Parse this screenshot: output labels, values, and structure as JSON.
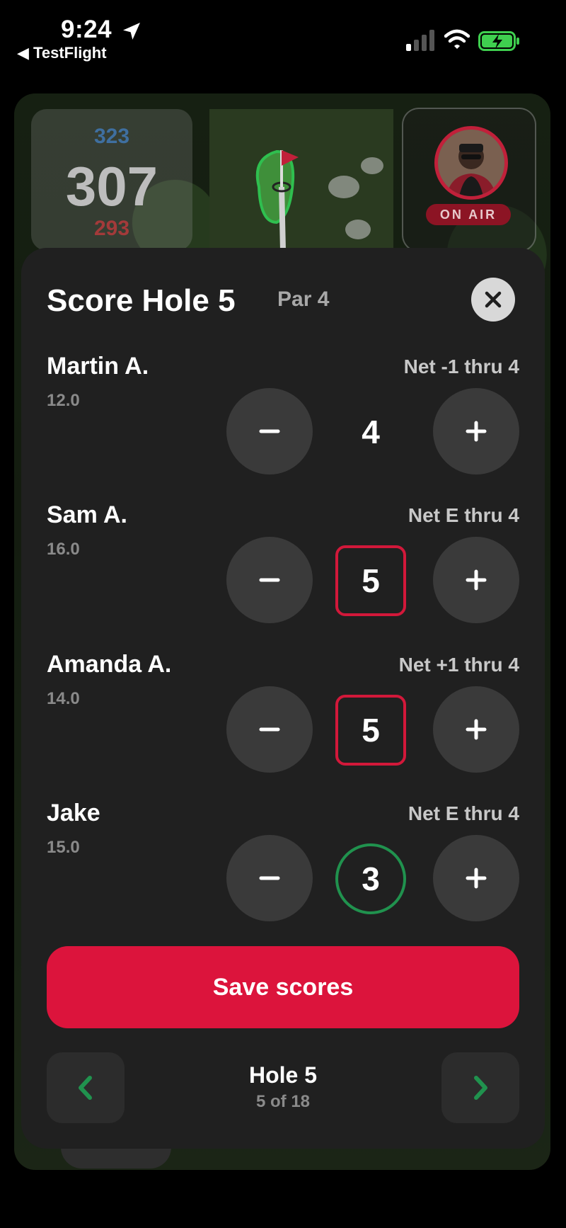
{
  "status_bar": {
    "time": "9:24",
    "back_app": "TestFlight"
  },
  "map_overlay": {
    "yardage_back": "323",
    "yardage_middle": "307",
    "yardage_front": "293",
    "on_air_label": "ON AIR"
  },
  "sheet": {
    "title": "Score Hole 5",
    "par": "Par 4",
    "players": [
      {
        "name": "Martin A.",
        "handicap": "12.0",
        "net": "Net -1 thru 4",
        "score": "4",
        "marker": "none"
      },
      {
        "name": "Sam A.",
        "handicap": "16.0",
        "net": "Net E thru 4",
        "score": "5",
        "marker": "box"
      },
      {
        "name": "Amanda A.",
        "handicap": "14.0",
        "net": "Net +1 thru 4",
        "score": "5",
        "marker": "box"
      },
      {
        "name": "Jake",
        "handicap": "15.0",
        "net": "Net E thru 4",
        "score": "3",
        "marker": "circle"
      }
    ],
    "save_label": "Save scores",
    "hole_nav": {
      "label": "Hole 5",
      "sub": "5 of 18"
    }
  },
  "colors": {
    "accent_red": "#dc143c",
    "birdie_green": "#20924e",
    "bogey_red": "#d2183a"
  }
}
